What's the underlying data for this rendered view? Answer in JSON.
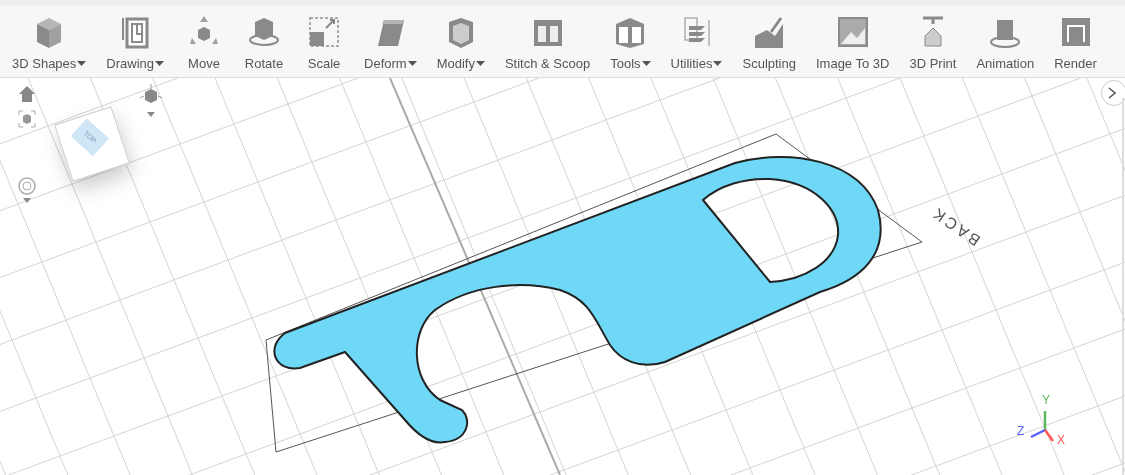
{
  "toolbar": {
    "items": [
      {
        "label": "3D Shapes",
        "dropdown": true
      },
      {
        "label": "Drawing",
        "dropdown": true
      },
      {
        "label": "Move",
        "dropdown": false
      },
      {
        "label": "Rotate",
        "dropdown": false
      },
      {
        "label": "Scale",
        "dropdown": false
      },
      {
        "label": "Deform",
        "dropdown": true
      },
      {
        "label": "Modify",
        "dropdown": true
      },
      {
        "label": "Stitch & Scoop",
        "dropdown": false
      },
      {
        "label": "Tools",
        "dropdown": true
      },
      {
        "label": "Utilities",
        "dropdown": true
      },
      {
        "label": "Sculpting",
        "dropdown": false
      },
      {
        "label": "Image To 3D",
        "dropdown": false
      },
      {
        "label": "3D Print",
        "dropdown": false
      },
      {
        "label": "Animation",
        "dropdown": false
      },
      {
        "label": "Render",
        "dropdown": false
      }
    ]
  },
  "view_cube": {
    "top_label": "TOP"
  },
  "viewport": {
    "back_label": "BACK"
  },
  "axes": {
    "x": "X",
    "y": "Y",
    "z": "Z"
  }
}
